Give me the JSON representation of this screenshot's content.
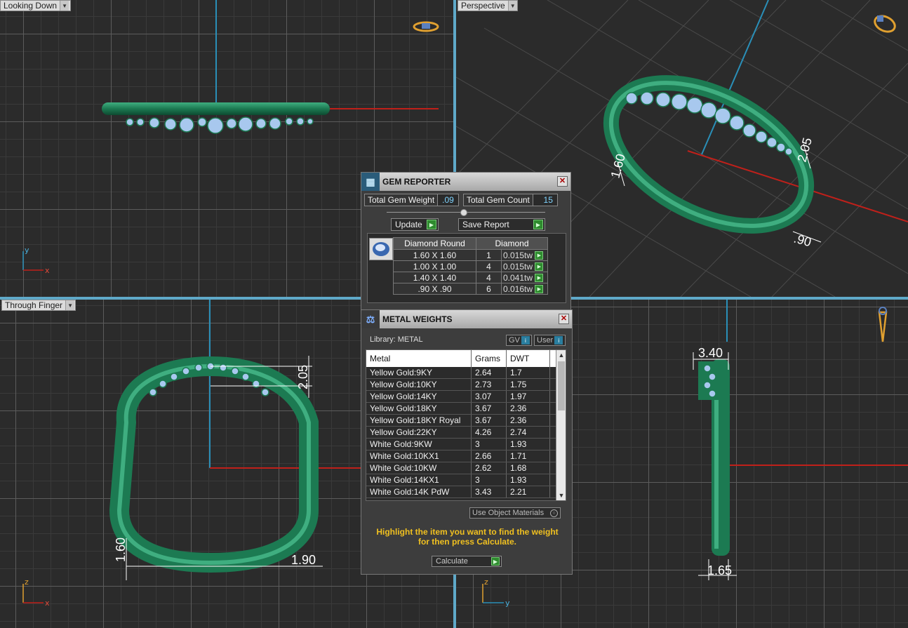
{
  "viewports": {
    "top_left": {
      "label": "Looking Down"
    },
    "top_right": {
      "label": "Perspective"
    },
    "bottom_left": {
      "label": "Through Finger"
    },
    "bottom_right": {
      "label": ""
    }
  },
  "axes": {
    "top_left": {
      "a": "y",
      "b": "x"
    },
    "bottom_left": {
      "a": "z",
      "b": "x"
    },
    "bottom_right": {
      "a": "z",
      "b": "y"
    }
  },
  "dimensions": {
    "top_right_a": "1.60",
    "top_right_b": "2.05",
    "top_right_c": ".90",
    "bottom_left_top": "2.05",
    "bottom_left_left": "1.60",
    "bottom_left_right": "1.90",
    "bottom_right_top": "3.40",
    "bottom_right_bottom": "1.65"
  },
  "gem_reporter": {
    "title": "GEM REPORTER",
    "total_weight_label": "Total Gem Weight",
    "total_weight_value": ".09",
    "total_count_label": "Total Gem Count",
    "total_count_value": "15",
    "update_label": "Update",
    "save_report_label": "Save Report",
    "header_shape": "Diamond Round",
    "header_material": "Diamond",
    "rows": [
      {
        "size": "1.60 X 1.60",
        "count": "1",
        "weight": "0.015tw"
      },
      {
        "size": "1.00 X 1.00",
        "count": "4",
        "weight": "0.015tw"
      },
      {
        "size": "1.40 X 1.40",
        "count": "4",
        "weight": "0.041tw"
      },
      {
        "size": ".90 X .90",
        "count": "6",
        "weight": "0.016tw"
      }
    ]
  },
  "metal_weights": {
    "title": "METAL WEIGHTS",
    "library_label": "Library: METAL",
    "gv_label": "GV",
    "user_label": "User",
    "columns": [
      "Metal",
      "Grams",
      "DWT"
    ],
    "rows": [
      {
        "metal": "Yellow Gold:9KY",
        "grams": "2.64",
        "dwt": "1.7"
      },
      {
        "metal": "Yellow Gold:10KY",
        "grams": "2.73",
        "dwt": "1.75"
      },
      {
        "metal": "Yellow Gold:14KY",
        "grams": "3.07",
        "dwt": "1.97"
      },
      {
        "metal": "Yellow Gold:18KY",
        "grams": "3.67",
        "dwt": "2.36"
      },
      {
        "metal": "Yellow Gold:18KY Royal",
        "grams": "3.67",
        "dwt": "2.36"
      },
      {
        "metal": "Yellow Gold:22KY",
        "grams": "4.26",
        "dwt": "2.74"
      },
      {
        "metal": "White Gold:9KW",
        "grams": "3",
        "dwt": "1.93"
      },
      {
        "metal": "White Gold:10KX1",
        "grams": "2.66",
        "dwt": "1.71"
      },
      {
        "metal": "White Gold:10KW",
        "grams": "2.62",
        "dwt": "1.68"
      },
      {
        "metal": "White Gold:14KX1",
        "grams": "3",
        "dwt": "1.93"
      },
      {
        "metal": "White Gold:14K PdW",
        "grams": "3.43",
        "dwt": "2.21"
      }
    ],
    "use_object_materials_label": "Use Object Materials",
    "hint": "Highlight the item you want to find the weight for then press Calculate.",
    "calculate_label": "Calculate"
  },
  "colors": {
    "viewport_bg": "#2b2b2b",
    "separator": "#5fa9c9",
    "ring_green": "#1f7a55",
    "gem_blue": "#a8c8ee",
    "axis_red": "#c0201a",
    "axis_blue": "#2a8fb8",
    "hint_text": "#f0c020"
  }
}
